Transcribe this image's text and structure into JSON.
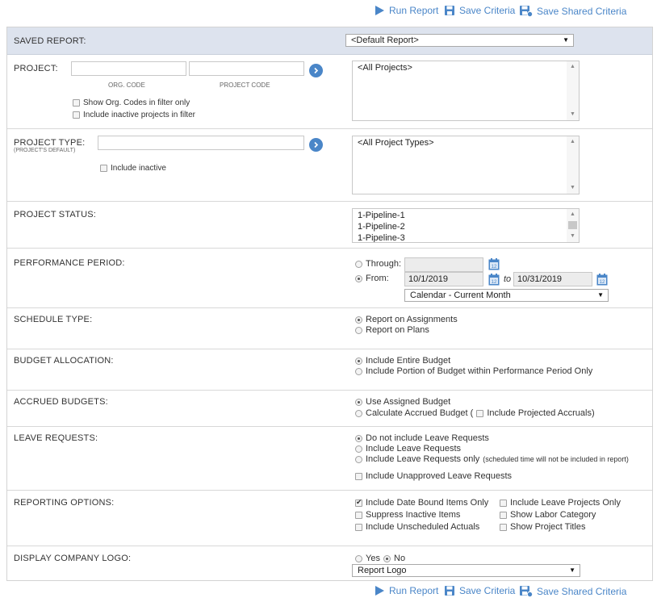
{
  "toolbar": {
    "run_report": "Run Report",
    "save_criteria": "Save Criteria",
    "save_shared_criteria": "Save Shared Criteria"
  },
  "saved_report": {
    "label": "SAVED REPORT:",
    "selected": "<Default Report>"
  },
  "project": {
    "label": "PROJECT:",
    "org_code_value": "",
    "project_code_value": "",
    "org_code_caption": "ORG. CODE",
    "project_code_caption": "PROJECT CODE",
    "show_org_codes": "Show Org. Codes in filter only",
    "include_inactive": "Include inactive projects in filter",
    "list": [
      "<All Projects>"
    ]
  },
  "project_type": {
    "label": "PROJECT TYPE:",
    "sublabel": "(PROJECT'S DEFAULT)",
    "value": "",
    "include_inactive": "Include inactive",
    "list": [
      "<All Project Types>"
    ]
  },
  "project_status": {
    "label": "PROJECT STATUS:",
    "list": [
      "1-Pipeline-1",
      "1-Pipeline-2",
      "1-Pipeline-3"
    ]
  },
  "performance_period": {
    "label": "PERFORMANCE PERIOD:",
    "through_label": "Through:",
    "through_value": "",
    "from_label": "From:",
    "from_value": "10/1/2019",
    "to_label": "to",
    "to_value": "10/31/2019",
    "period_selected": "Calendar - Current Month"
  },
  "schedule_type": {
    "label": "SCHEDULE TYPE:",
    "opt1": "Report on Assignments",
    "opt2": "Report on Plans"
  },
  "budget_allocation": {
    "label": "BUDGET ALLOCATION:",
    "opt1": "Include Entire Budget",
    "opt2": "Include Portion of Budget within Performance Period Only"
  },
  "accrued_budgets": {
    "label": "ACCRUED BUDGETS:",
    "opt1": "Use Assigned Budget",
    "opt2": "Calculate Accrued Budget (",
    "opt2_check": "Include Projected Accruals)"
  },
  "leave_requests": {
    "label": "LEAVE REQUESTS:",
    "opt1": "Do not include Leave Requests",
    "opt2": "Include Leave Requests",
    "opt3": "Include Leave Requests only",
    "opt3_note": "(scheduled time will not be included in report)",
    "unapproved": "Include Unapproved Leave Requests"
  },
  "reporting_options": {
    "label": "REPORTING OPTIONS:",
    "date_bound": "Include Date Bound Items Only",
    "leave_projects": "Include Leave Projects Only",
    "suppress_inactive": "Suppress Inactive Items",
    "labor_category": "Show Labor Category",
    "unscheduled_actuals": "Include Unscheduled Actuals",
    "project_titles": "Show Project Titles"
  },
  "company_logo": {
    "label": "DISPLAY COMPANY LOGO:",
    "yes": "Yes",
    "no": "No",
    "logo_selected": "Report Logo"
  }
}
